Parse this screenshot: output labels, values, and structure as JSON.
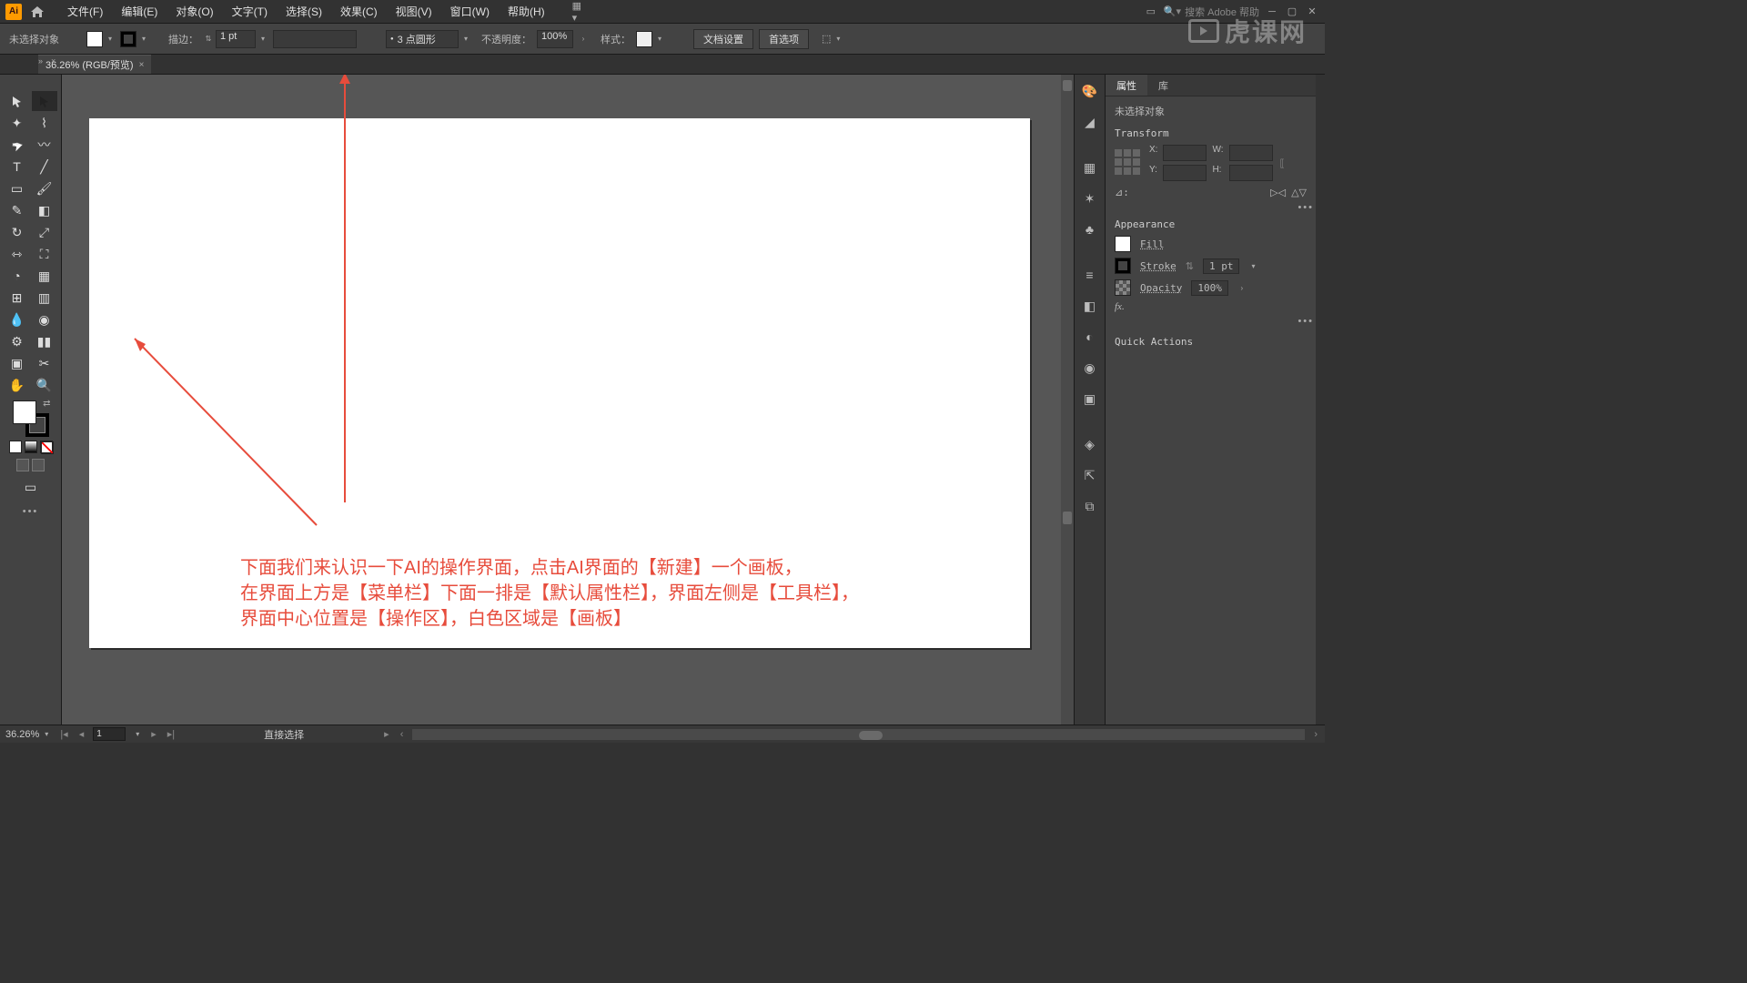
{
  "menubar": {
    "logo": "Ai",
    "items": [
      "文件(F)",
      "编辑(E)",
      "对象(O)",
      "文字(T)",
      "选择(S)",
      "效果(C)",
      "视图(V)",
      "窗口(W)",
      "帮助(H)"
    ],
    "search_placeholder": "搜索 Adobe 帮助"
  },
  "controlbar": {
    "no_selection": "未选择对象",
    "stroke_label": "描边：",
    "stroke_value": "1 pt",
    "brush_value": "3 点圆形",
    "opacity_label": "不透明度：",
    "opacity_value": "100%",
    "style_label": "样式：",
    "btn_docsetup": "文档设置",
    "btn_prefs": "首选项"
  },
  "doctab": {
    "title": "36.26% (RGB/预览)"
  },
  "canvas": {
    "annotation_line1": "下面我们来认识一下AI的操作界面，点击AI界面的【新建】一个画板，",
    "annotation_line2": "在界面上方是【菜单栏】下面一排是【默认属性栏】，界面左侧是【工具栏】，",
    "annotation_line3": "界面中心位置是【操作区】，白色区域是【画板】"
  },
  "properties": {
    "tab_props": "属性",
    "tab_lib": "库",
    "no_selection": "未选择对象",
    "section_transform": "Transform",
    "tf": {
      "x_label": "X:",
      "y_label": "Y:",
      "w_label": "W:",
      "h_label": "H:",
      "angle_label": "⊿:"
    },
    "section_appearance": "Appearance",
    "fill_label": "Fill",
    "stroke_label": "Stroke",
    "stroke_value": "1 pt",
    "opacity_label": "Opacity",
    "opacity_value": "100%",
    "fx": "fx.",
    "quick_actions": "Quick Actions"
  },
  "statusbar": {
    "zoom": "36.26%",
    "artboard": "1",
    "tool_hint": "直接选择"
  },
  "watermark": "虎课网"
}
